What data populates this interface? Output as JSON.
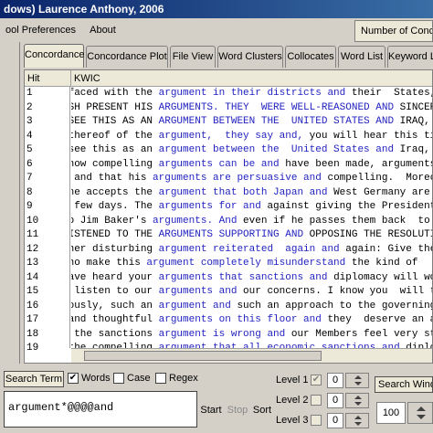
{
  "window": {
    "title": "dows) Laurence Anthony, 2006"
  },
  "menu": {
    "items": [
      "ool Preferences",
      "About"
    ]
  },
  "corpus_label": "Number of Concor",
  "tabs": [
    {
      "label": "Concordance",
      "active": true
    },
    {
      "label": "Concordance Plot",
      "active": false
    },
    {
      "label": "File View",
      "active": false
    },
    {
      "label": "Word Clusters",
      "active": false
    },
    {
      "label": "Collocates",
      "active": false
    },
    {
      "label": "Word List",
      "active": false
    },
    {
      "label": "Keyword L",
      "active": false
    }
  ],
  "table": {
    "headers": {
      "hit": "Hit",
      "kwic": "KWIC"
    },
    "rows": [
      {
        "hit": "1",
        "left": " faced with the ",
        "kw": "argument in their districts and",
        "right": " their  States, "
      },
      {
        "hit": "2",
        "left": "USH PRESENT HIS ",
        "kw": "ARGUMENTS. THEY  WERE WELL-REASONED AND",
        "right": " SINCERE"
      },
      {
        "hit": "3",
        "left": " SEE THIS AS AN ",
        "kw": "ARGUMENT BETWEEN THE  UNITED STATES AND",
        "right": " IRAQ, A"
      },
      {
        "hit": "4",
        "left": " thereof of the ",
        "kw": "argument,  they say and,",
        "right": " you will hear this tim"
      },
      {
        "hit": "5",
        "left": " see this as an ",
        "kw": "argument between the  United States and",
        "right": " Iraq, "
      },
      {
        "hit": "6",
        "left": "know compelling ",
        "kw": "arguments can be and",
        "right": " have been made, arguments "
      },
      {
        "hit": "7",
        "left": ", and that his ",
        "kw": "arguments are persuasive and",
        "right": " compelling.  Morec"
      },
      {
        "hit": "8",
        "left": "one accepts the ",
        "kw": "argument that both Japan and",
        "right": " West Germany are helpin"
      },
      {
        "hit": "9",
        "left": "  few days. The ",
        "kw": "arguments for and",
        "right": " against giving the President "
      },
      {
        "hit": "10",
        "left": "to Jim Baker's ",
        "kw": "arguments. And",
        "right": " even if he passes them back  to "
      },
      {
        "hit": "11",
        "left": "LISTENED TO THE ",
        "kw": "ARGUMENTS SUPPORTING AND",
        "right": " OPPOSING THE RESOLUTIO"
      },
      {
        "hit": "12",
        "left": "ther disturbing ",
        "kw": "argument reiterated  again and",
        "right": " again: Give the "
      },
      {
        "hit": "13",
        "left": "who make this ",
        "kw": "argument completely misunderstand",
        "right": " the kind of "
      },
      {
        "hit": "14",
        "left": "have heard your ",
        "kw": "arguments that sanctions and",
        "right": " diplomacy will work "
      },
      {
        "hit": "15",
        "left": "l listen to our ",
        "kw": "arguments and",
        "right": " our concerns. I know you  will ta"
      },
      {
        "hit": "16",
        "left": "iously, such an ",
        "kw": "argument and",
        "right": " such an approach to the governing "
      },
      {
        "hit": "17",
        "left": " and thoughtful ",
        "kw": "arguments on this floor and",
        "right": " they  deserve an ar"
      },
      {
        "hit": "18",
        "left": "o the sanctions ",
        "kw": "argument is wrong and",
        "right": " our Members feel very str"
      },
      {
        "hit": "19",
        "left": " the compelling ",
        "kw": "argument that all economic sanctions and",
        "right": " diplo"
      }
    ]
  },
  "search": {
    "tab_label": "Search Term",
    "words_label": "Words",
    "words_checked": true,
    "case_label": "Case",
    "case_checked": false,
    "regex_label": "Regex",
    "regex_checked": false,
    "query": "argument*@@@@and",
    "start_label": "Start",
    "stop_label": "Stop",
    "sort_label": "Sort"
  },
  "levels": [
    {
      "label": "Level 1",
      "value": "0",
      "checked": true
    },
    {
      "label": "Level 2",
      "value": "0",
      "checked": false
    },
    {
      "label": "Level 3",
      "value": "0",
      "checked": false
    }
  ],
  "search_window": {
    "label": "Search Windo",
    "value": "100"
  },
  "icons": {
    "check": "checkmark-icon",
    "spin_up": "spin-up-icon",
    "spin_down": "spin-down-icon"
  },
  "colors": {
    "keyword": "#1f1fc0",
    "titlebar": "#0a246a"
  }
}
